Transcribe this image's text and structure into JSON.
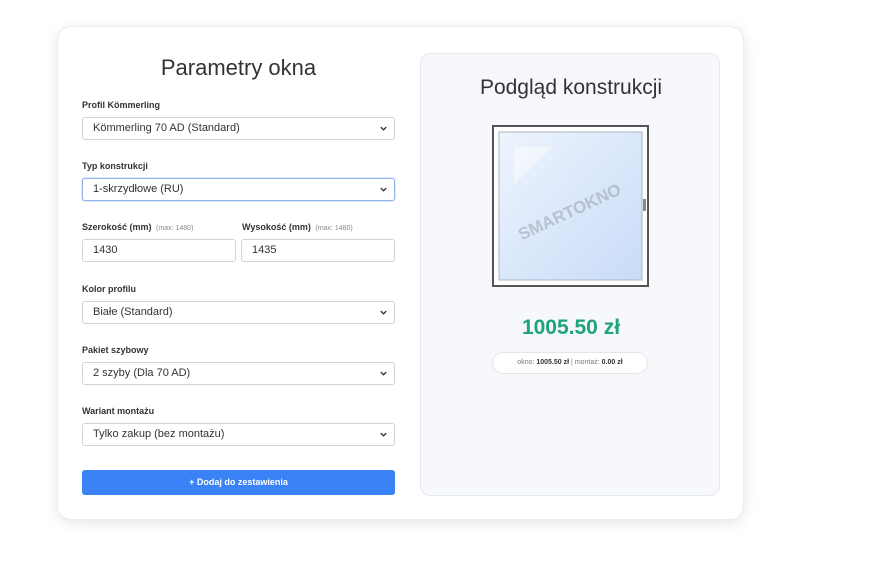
{
  "form": {
    "title": "Parametry okna",
    "profile": {
      "label": "Profil Kömmerling",
      "value": "Kömmerling 70 AD (Standard)"
    },
    "construction": {
      "label": "Typ konstrukcji",
      "value": "1-skrzydłowe (RU)"
    },
    "width": {
      "label": "Szerokość (mm)",
      "hint": "(max: 1480)",
      "value": "1430"
    },
    "height": {
      "label": "Wysokość (mm)",
      "hint": "(max: 1480)",
      "value": "1435"
    },
    "color": {
      "label": "Kolor profilu",
      "value": "Białe (Standard)"
    },
    "glazing": {
      "label": "Pakiet szybowy",
      "value": "2 szyby (Dla 70 AD)"
    },
    "mounting": {
      "label": "Wariant montażu",
      "value": "Tylko zakup (bez montażu)"
    },
    "add_button": "+ Dodaj do zestawienia"
  },
  "preview": {
    "title": "Podgląd konstrukcji",
    "watermark": "SMARTOKNO",
    "price": "1005.50 zł",
    "breakdown": {
      "window_label": "okno:",
      "window_value": "1005.50 zł",
      "separator": "|",
      "mounting_label": "montaż:",
      "mounting_value": "0.00 zł"
    }
  },
  "colors": {
    "accent": "#3b82f6",
    "price": "#1fa37a",
    "glass": "#dbe8fb"
  }
}
